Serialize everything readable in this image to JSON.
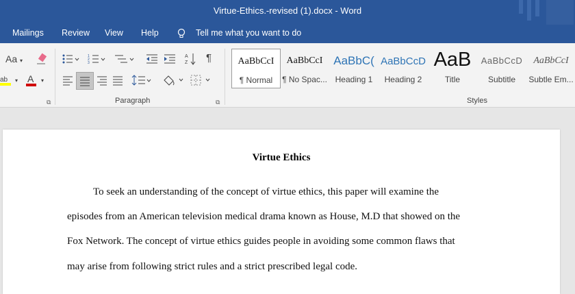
{
  "window": {
    "title": "Virtue-Ethics.-revised (1).docx  -  Word"
  },
  "tabs": [
    {
      "label": "Mailings"
    },
    {
      "label": "Review"
    },
    {
      "label": "View"
    },
    {
      "label": "Help"
    }
  ],
  "tell_me": {
    "placeholder": "Tell me what you want to do",
    "icon": "lightbulb-icon"
  },
  "ribbon": {
    "font_group_partial": {
      "change_case_label": "Aa",
      "highlight_color": "#ffff00",
      "font_color": "#d00000"
    },
    "paragraph_group": {
      "label": "Paragraph"
    },
    "styles_group": {
      "label": "Styles",
      "items": [
        {
          "sample": "AaBbCcI",
          "name": "¶ Normal",
          "selected": true
        },
        {
          "sample": "AaBbCcI",
          "name": "¶ No Spac..."
        },
        {
          "sample": "AaBbC(",
          "name": "Heading 1"
        },
        {
          "sample": "AaBbCcD",
          "name": "Heading 2"
        },
        {
          "sample": "AaB",
          "name": "Title"
        },
        {
          "sample": "AaBbCcD",
          "name": "Subtitle"
        },
        {
          "sample": "AaBbCcI",
          "name": "Subtle Em..."
        }
      ]
    }
  },
  "document": {
    "title": "Virtue Ethics",
    "lines": [
      "To seek an understanding of the concept of virtue ethics, this paper will examine the",
      "episodes from an American television medical drama known as House, M.D that showed on the",
      "Fox Network. The concept of virtue ethics guides people in avoiding some common flaws that",
      "may arise from following strict rules and a strict prescribed legal code."
    ]
  },
  "colors": {
    "accent": "#2b579a",
    "ribbon_bg": "#f3f3f3",
    "canvas_bg": "#e6e6e6"
  }
}
